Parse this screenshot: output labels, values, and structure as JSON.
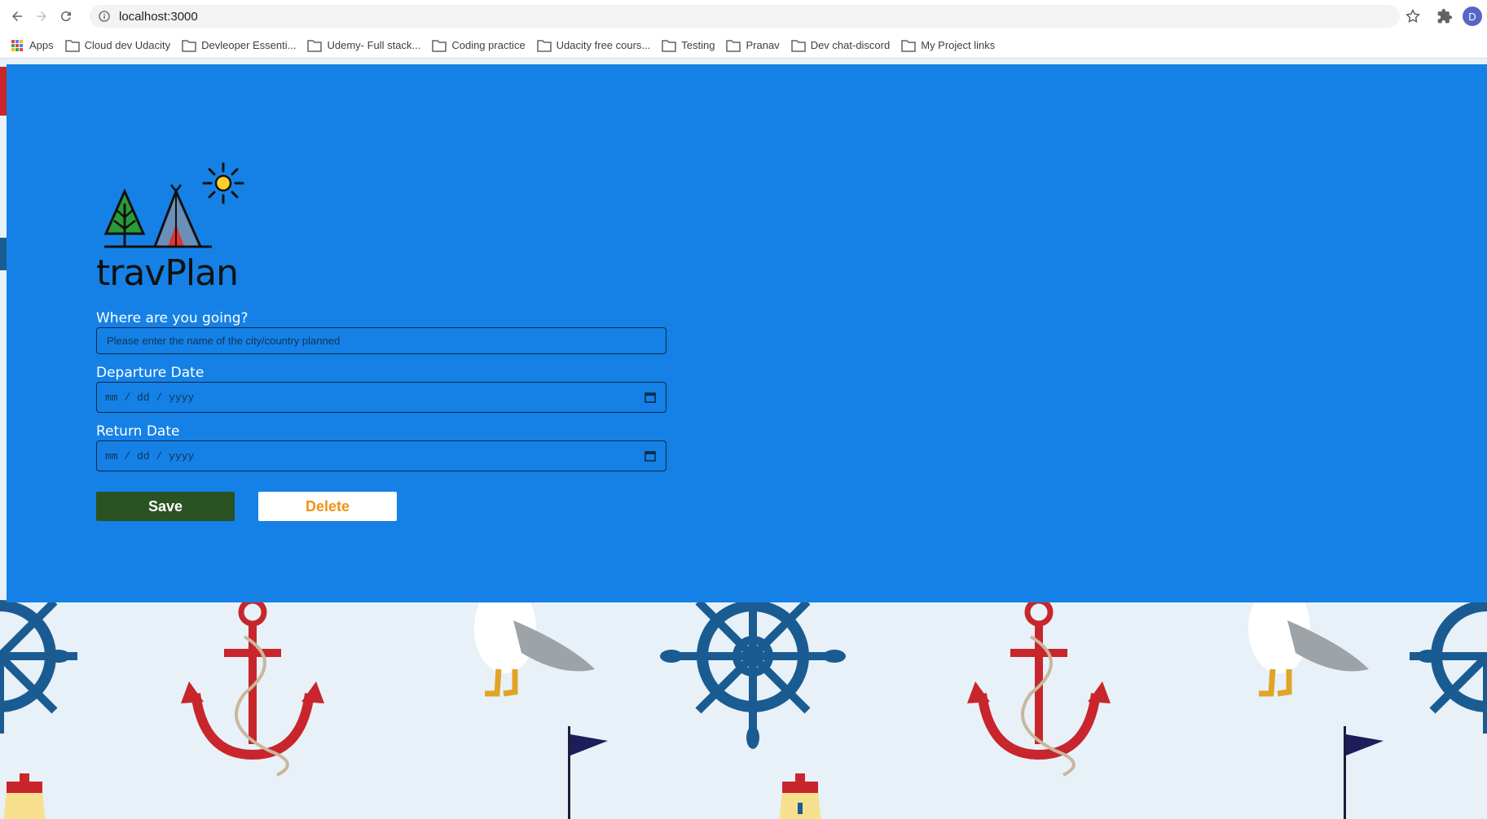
{
  "browser": {
    "url": "localhost:3000",
    "avatar_letter": "D"
  },
  "bookmarks": {
    "apps_label": "Apps",
    "items": [
      {
        "label": "Cloud dev Udacity"
      },
      {
        "label": "Devleoper Essenti..."
      },
      {
        "label": "Udemy- Full stack..."
      },
      {
        "label": "Coding practice"
      },
      {
        "label": "Udacity free cours..."
      },
      {
        "label": "Testing"
      },
      {
        "label": "Pranav"
      },
      {
        "label": "Dev chat-discord"
      },
      {
        "label": "My Project links"
      }
    ]
  },
  "app": {
    "brand": "travPlan",
    "destination": {
      "label": "Where are you going?",
      "placeholder": "Please enter the name of the city/country planned"
    },
    "departure": {
      "label": "Departure Date",
      "placeholder": "mm / dd / yyyy"
    },
    "return": {
      "label": "Return Date",
      "placeholder": "mm / dd / yyyy"
    },
    "save_label": "Save",
    "delete_label": "Delete"
  },
  "colors": {
    "hero": "#1581e6",
    "save": "#2a5222",
    "delete_text": "#f29017"
  }
}
